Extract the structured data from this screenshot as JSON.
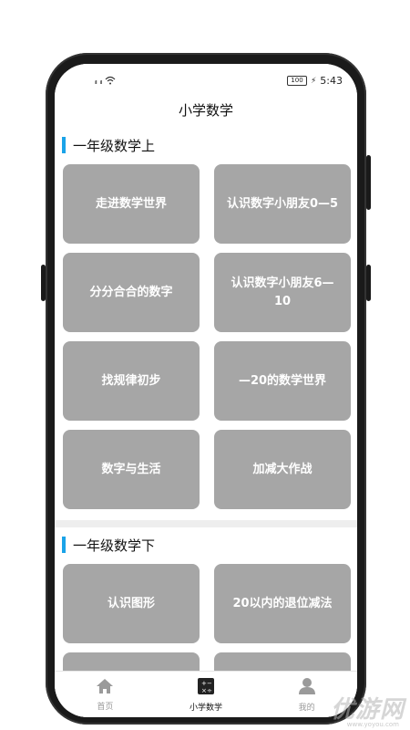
{
  "status_bar": {
    "signal_1": "ᵢₗₗ",
    "signal_2": "ᵢₗₗ",
    "wifi": "wifi-icon",
    "battery_label": "100",
    "time": "5:43"
  },
  "app": {
    "title": "小学数学"
  },
  "sections": [
    {
      "title": "一年级数学上",
      "items": [
        "走进数学世界",
        "认识数字小朋友0—5",
        "分分合合的数字",
        "认识数字小朋友6—10",
        "找规律初步",
        "—20的数学世界",
        "数字与生活",
        "加减大作战"
      ]
    },
    {
      "title": "一年级数学下",
      "items": [
        "认识图形",
        "20以内的退位减法",
        "",
        ""
      ]
    }
  ],
  "tabbar": {
    "tabs": [
      {
        "label": "首页",
        "icon": "home-icon"
      },
      {
        "label": "小学数学",
        "icon": "calculator-icon"
      },
      {
        "label": "我的",
        "icon": "person-icon"
      }
    ],
    "active_index": 1
  },
  "watermark": {
    "text": "优游网",
    "url": "www.yoyou.com"
  },
  "colors": {
    "accent": "#1aa3e8",
    "tile": "#a6a6a6"
  }
}
